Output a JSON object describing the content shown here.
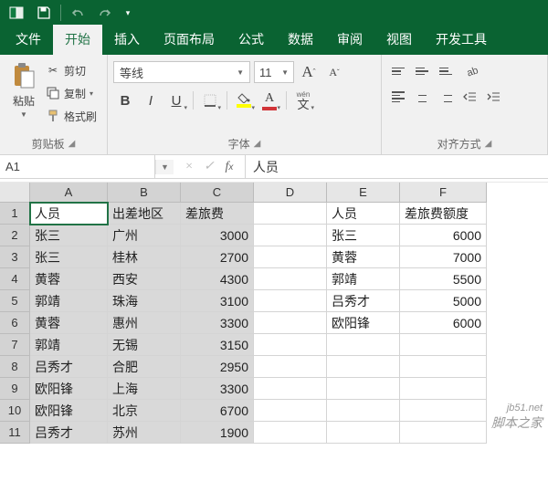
{
  "titlebar": {
    "icons": [
      "excel",
      "save",
      "undo",
      "redo",
      "down"
    ]
  },
  "tabs": {
    "items": [
      "文件",
      "开始",
      "插入",
      "页面布局",
      "公式",
      "数据",
      "审阅",
      "视图",
      "开发工具"
    ],
    "active": 1
  },
  "ribbon": {
    "clipboard": {
      "paste": "粘贴",
      "cut": "剪切",
      "copy": "复制",
      "painter": "格式刷",
      "group": "剪贴板"
    },
    "font": {
      "name": "等线",
      "size": "11",
      "group": "字体",
      "wen": "wén"
    },
    "align": {
      "group": "对齐方式"
    }
  },
  "namebox": "A1",
  "formula": "人员",
  "columns": [
    "A",
    "B",
    "C",
    "D",
    "E",
    "F"
  ],
  "rows": [
    {
      "n": "1",
      "A": "人员",
      "B": "出差地区",
      "C": "差旅费",
      "D": "",
      "E": "人员",
      "F": "差旅费额度"
    },
    {
      "n": "2",
      "A": "张三",
      "B": "广州",
      "C": "3000",
      "D": "",
      "E": "张三",
      "F": "6000"
    },
    {
      "n": "3",
      "A": "张三",
      "B": "桂林",
      "C": "2700",
      "D": "",
      "E": "黄蓉",
      "F": "7000"
    },
    {
      "n": "4",
      "A": "黄蓉",
      "B": "西安",
      "C": "4300",
      "D": "",
      "E": "郭靖",
      "F": "5500"
    },
    {
      "n": "5",
      "A": "郭靖",
      "B": "珠海",
      "C": "3100",
      "D": "",
      "E": "吕秀才",
      "F": "5000"
    },
    {
      "n": "6",
      "A": "黄蓉",
      "B": "惠州",
      "C": "3300",
      "D": "",
      "E": "欧阳锋",
      "F": "6000"
    },
    {
      "n": "7",
      "A": "郭靖",
      "B": "无锡",
      "C": "3150",
      "D": "",
      "E": "",
      "F": ""
    },
    {
      "n": "8",
      "A": "吕秀才",
      "B": "合肥",
      "C": "2950",
      "D": "",
      "E": "",
      "F": ""
    },
    {
      "n": "9",
      "A": "欧阳锋",
      "B": "上海",
      "C": "3300",
      "D": "",
      "E": "",
      "F": ""
    },
    {
      "n": "10",
      "A": "欧阳锋",
      "B": "北京",
      "C": "6700",
      "D": "",
      "E": "",
      "F": ""
    },
    {
      "n": "11",
      "A": "吕秀才",
      "B": "苏州",
      "C": "1900",
      "D": "",
      "E": "",
      "F": ""
    }
  ],
  "watermark": "脚本之家",
  "watermark_url": "jb51.net"
}
